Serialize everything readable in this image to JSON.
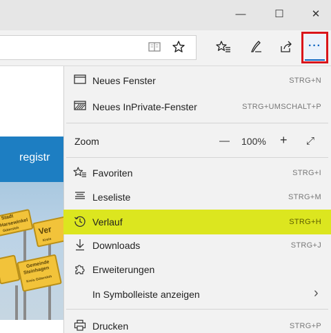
{
  "window": {
    "minimize_glyph": "—",
    "maximize_glyph": "☐",
    "close_glyph": "✕"
  },
  "toolbar": {
    "reading_view_icon": "reading-view-icon",
    "favorite_icon": "star-icon",
    "favorites_hub_icon": "favorites-hub-icon",
    "notes_icon": "pen-icon",
    "share_icon": "share-icon",
    "more_glyph": "···",
    "highlight_outline_color": "#d9151b"
  },
  "page": {
    "band_text": "registr",
    "sign_texts": [
      "Stadt",
      "Harsewinkel",
      "Gütersloh",
      "Ver",
      "Kreis",
      "Gemeinde",
      "Steinhagen",
      "Kreis Gütersloh"
    ]
  },
  "menu": {
    "items": [
      {
        "label": "Neues Fenster",
        "shortcut": "STRG+N",
        "icon": "window-icon"
      },
      {
        "label": "Neues InPrivate-Fenster",
        "shortcut": "STRG+UMSCHALT+P",
        "icon": "inprivate-window-icon"
      },
      {
        "label": "Zoom",
        "zoom_value": "100%",
        "zoom_minus": "—",
        "zoom_plus": "+",
        "zoom_full": "⤢"
      },
      {
        "label": "Favoriten",
        "shortcut": "STRG+I",
        "icon": "favorites-icon"
      },
      {
        "label": "Leseliste",
        "shortcut": "STRG+M",
        "icon": "reading-list-icon"
      },
      {
        "label": "Verlauf",
        "shortcut": "STRG+H",
        "icon": "history-icon",
        "highlighted": true,
        "highlight_color": "#dce61f"
      },
      {
        "label": "Downloads",
        "shortcut": "STRG+J",
        "icon": "download-icon"
      },
      {
        "label": "Erweiterungen",
        "shortcut": "",
        "icon": "extensions-icon"
      },
      {
        "label": "In Symbolleiste anzeigen",
        "shortcut": "",
        "chevron": "›"
      },
      {
        "label": "Drucken",
        "shortcut": "STRG+P",
        "icon": "print-icon"
      }
    ]
  }
}
